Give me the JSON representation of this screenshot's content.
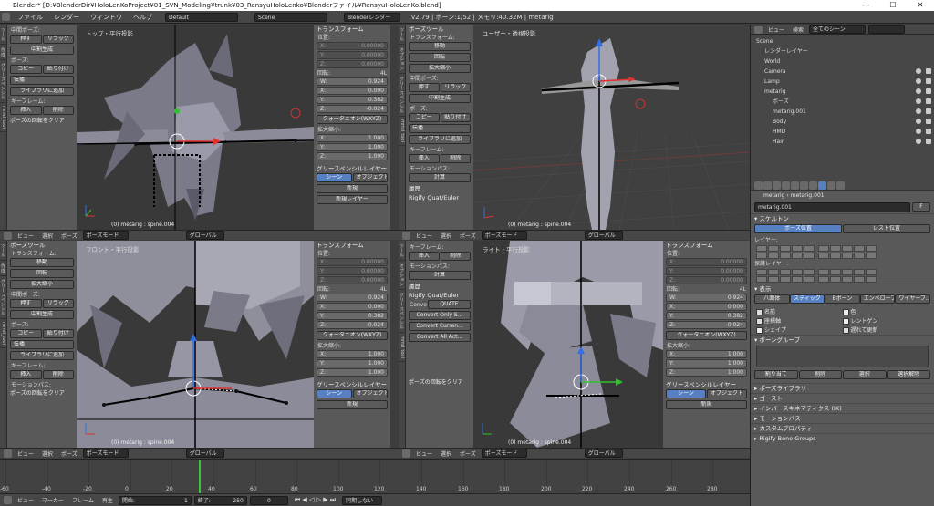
{
  "window": {
    "title": "Blender* [D:¥BlenderDir¥HoloLenKoProject¥01_SVN_Modeling¥trunk¥03_RensyuHoloLenko¥Blenderファイル¥RensyuHoloLenKo.blend]",
    "min": "—",
    "max": "☐",
    "close": "✕"
  },
  "menu": {
    "items": [
      "ファイル",
      "レンダー",
      "ウィンドウ",
      "ヘルプ"
    ],
    "layout": "Default",
    "scene": "Scene",
    "engine": "Blenderレンダー",
    "stats": "v2.79 | ボーン:1/52 | メモリ:40.32M | metarig"
  },
  "viewports": {
    "tl": {
      "label": "トップ・平行投影",
      "obj": "(0) metarig : spine.004"
    },
    "tr": {
      "label": "ユーザー・透視投影",
      "obj": "(0) metarig : spine.004"
    },
    "bl": {
      "label": "フロント・平行投影",
      "obj": "(0) metarig : spine.004"
    },
    "br": {
      "label": "ライト・平行投影",
      "obj": "(0) metarig : spine.004"
    }
  },
  "vp_header": {
    "view": "ビュー",
    "select": "選択",
    "pose": "ポーズ",
    "mode": "ポーズモード",
    "global": "グローバル"
  },
  "tools": {
    "tab1": "ツール",
    "tab2": "作成",
    "tab3": "グリースペンシル",
    "tab4": "mmd_tool",
    "tab5": "オプション",
    "head": "ポーズツール",
    "transform": "トランスフォーム:",
    "move": "移動",
    "rotate": "回転",
    "scale": "拡大縮小",
    "inbetween": "中間ポーズ:",
    "push": "押す",
    "relax": "リラック",
    "breakdown": "中割生成",
    "pose": "ポーズ:",
    "copy": "コピー",
    "paste": "貼り付け",
    "propagate": "伝播",
    "addlib": "ライブラリに追加",
    "keyframe": "キーフレーム:",
    "insert": "挿入",
    "delete": "削除",
    "motionpath": "モーションパス:",
    "calc": "計算",
    "history": "履歴",
    "rigify": "Rigify Quat/Euler",
    "convert": "Conve",
    "quat": "QUATE",
    "conv1": "Convert Only S...",
    "conv2": "Convert Curren...",
    "conv3": "Convert All Act...",
    "clearxf": "ポーズの回転をクリア"
  },
  "props": {
    "transform": "トランスフォーム",
    "location": "位置:",
    "rotation": "回転:",
    "rotmode": "4L",
    "loc": [
      {
        "a": "X:",
        "v": "0.00000"
      },
      {
        "a": "Y:",
        "v": "0.00000"
      },
      {
        "a": "Z:",
        "v": "0.00000"
      }
    ],
    "rot": [
      {
        "a": "W:",
        "v": "0.924"
      },
      {
        "a": "X:",
        "v": "0.000"
      },
      {
        "a": "Y:",
        "v": "0.382"
      },
      {
        "a": "Z:",
        "v": "-0.024"
      }
    ],
    "quat": "クォータニオン(WXYZ)",
    "scale": "拡大縮小:",
    "scl": [
      {
        "a": "X:",
        "v": "1.000"
      },
      {
        "a": "Y:",
        "v": "1.000"
      },
      {
        "a": "Z:",
        "v": "1.000"
      }
    ],
    "grease": "グリースペンシルレイヤー",
    "scene": "シーン",
    "object": "オブジェクト",
    "new": "新規",
    "newlayer": "新規レイヤー"
  },
  "outliner": {
    "view": "ビュー",
    "search": "検索",
    "allscenes": "全てのシーン",
    "rows": [
      {
        "indent": 0,
        "t": "Scene"
      },
      {
        "indent": 1,
        "t": "レンダーレイヤー"
      },
      {
        "indent": 1,
        "t": "World"
      },
      {
        "indent": 1,
        "t": "Camera"
      },
      {
        "indent": 1,
        "t": "Lamp"
      },
      {
        "indent": 1,
        "t": "metarig"
      },
      {
        "indent": 2,
        "t": "ポーズ"
      },
      {
        "indent": 2,
        "t": "metarig.001"
      },
      {
        "indent": 2,
        "t": "Body"
      },
      {
        "indent": 2,
        "t": "HMD"
      },
      {
        "indent": 2,
        "t": "Hair"
      }
    ]
  },
  "properties": {
    "crumb1": "metarig",
    "crumb2": "metarig.001",
    "bone": "metarig.001",
    "f": "F",
    "skeleton": "スケルトン",
    "posepos": "ポーズ位置",
    "restpos": "レスト位置",
    "layers": "レイヤー:",
    "protected": "保護レイヤー:",
    "display": "表示",
    "disp_modes": [
      "八面体",
      "スティック",
      "Bボーン",
      "エンベロープ",
      "ワイヤーフ..."
    ],
    "names": "名前",
    "axes": "座標軸",
    "shapes": "シェイプ",
    "colors": "色",
    "xray": "レントゲン",
    "delay": "遅れて更新",
    "bonegroups": "ボーングループ",
    "assign": "割り当て",
    "remove": "削除",
    "select": "選択",
    "deselect": "選択解除",
    "sections": [
      "ポーズライブラリ",
      "ゴースト",
      "インバースキネマティクス (IK)",
      "モーションパス",
      "カスタムプロパティ",
      "Rigify Bone Groups"
    ]
  },
  "timeline": {
    "ticks": [
      "-60",
      "-40",
      "-20",
      "0",
      "20",
      "40",
      "60",
      "80",
      "100",
      "120",
      "140",
      "160",
      "180",
      "200",
      "220",
      "240",
      "260",
      "280"
    ],
    "view": "ビュー",
    "marker": "マーカー",
    "frame": "フレーム",
    "play": "再生",
    "start_label": "開始:",
    "start": "1",
    "end_label": "終了:",
    "end": "250",
    "cur": "0",
    "sync": "同期しない"
  },
  "colors": {
    "accent": "#5680c2",
    "bone": "#000000",
    "select": "#ffffff",
    "axis_x": "#e03030",
    "axis_y": "#30c030",
    "axis_z": "#3070e0"
  }
}
